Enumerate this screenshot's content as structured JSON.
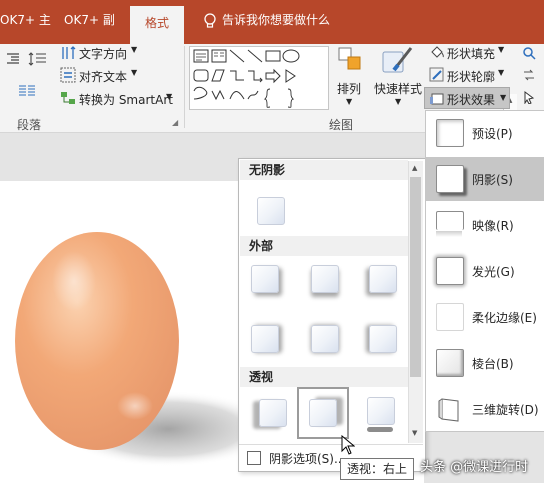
{
  "tabs": [
    {
      "label": "OK7+ 主"
    },
    {
      "label": "OK7+ 副"
    },
    {
      "label": "格式"
    }
  ],
  "tell_me": {
    "placeholder": "告诉我你想要做什么"
  },
  "ribbon": {
    "paragraph": {
      "text_direction": "文字方向",
      "align_text": "对齐文本",
      "convert_smartart": "转换为 SmartArt",
      "label": "段落"
    },
    "drawing": {
      "arrange": "排列",
      "quick_styles": "快速样式",
      "shape_fill": "形状填充",
      "shape_outline": "形状轮廓",
      "shape_effects": "形状效果",
      "label": "绘图"
    }
  },
  "shadow_gallery": {
    "sections": [
      {
        "title": "无阴影"
      },
      {
        "title": "外部"
      },
      {
        "title": "透视"
      }
    ],
    "options_label": "阴影选项(S)..."
  },
  "effects_menu": {
    "items": [
      {
        "label": "预设(P)",
        "icon": "preset-icon"
      },
      {
        "label": "阴影(S)",
        "icon": "shadow-icon"
      },
      {
        "label": "映像(R)",
        "icon": "reflection-icon"
      },
      {
        "label": "发光(G)",
        "icon": "glow-icon"
      },
      {
        "label": "柔化边缘(E)",
        "icon": "soft-edges-icon"
      },
      {
        "label": "棱台(B)",
        "icon": "bevel-icon"
      },
      {
        "label": "三维旋转(D)",
        "icon": "3d-rotation-icon"
      }
    ]
  },
  "tooltip": {
    "text": "透视：右上"
  },
  "watermark": {
    "text": "头条 @微课进行时"
  },
  "colors": {
    "accent": "#b7472a",
    "egg": "#f2a877",
    "menu_hover": "#c6c6c6"
  }
}
